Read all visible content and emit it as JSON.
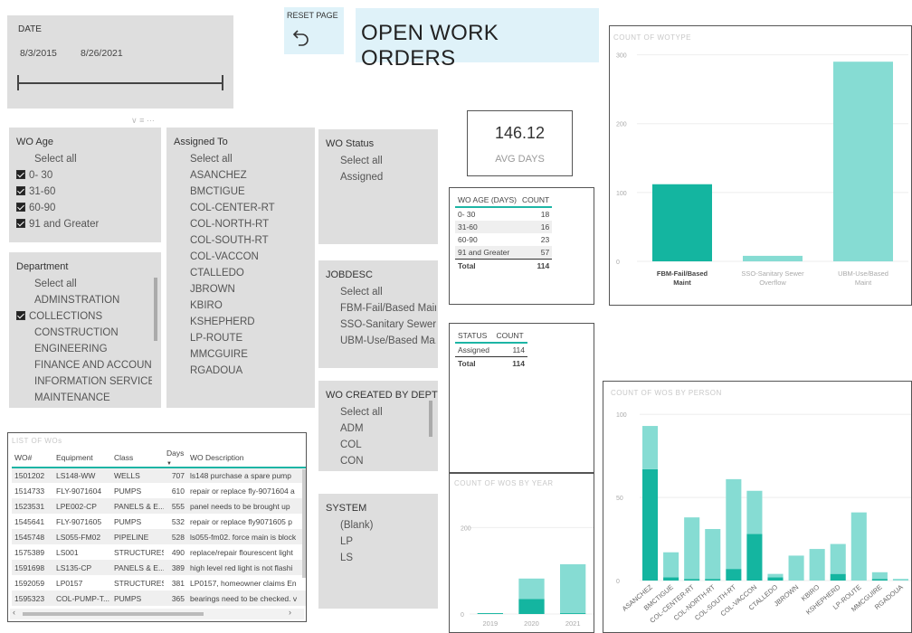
{
  "date_slicer": {
    "title": "DATE",
    "start": "8/3/2015",
    "end": "8/26/2021"
  },
  "reset": {
    "label": "RESET PAGE",
    "icon": "undo-arrow-icon"
  },
  "page_title": "OPEN WORK ORDERS",
  "avg_card": {
    "value": "146.12",
    "label": "AVG DAYS"
  },
  "wo_age_slicer": {
    "title": "WO Age",
    "items": [
      {
        "label": "Select all",
        "checked": false,
        "has_box": false
      },
      {
        "label": "0- 30",
        "checked": true,
        "has_box": true
      },
      {
        "label": "31-60",
        "checked": true,
        "has_box": true
      },
      {
        "label": "60-90",
        "checked": true,
        "has_box": true
      },
      {
        "label": "91 and Greater",
        "checked": true,
        "has_box": true
      }
    ]
  },
  "department_slicer": {
    "title": "Department",
    "items": [
      {
        "label": "Select all",
        "checked": false
      },
      {
        "label": "ADMINSTRATION",
        "checked": false
      },
      {
        "label": "COLLECTIONS",
        "checked": true
      },
      {
        "label": "CONSTRUCTION",
        "checked": false
      },
      {
        "label": "ENGINEERING",
        "checked": false
      },
      {
        "label": "FINANCE AND ACCOUNTI...",
        "checked": false
      },
      {
        "label": "INFORMATION SERVICES",
        "checked": false
      },
      {
        "label": "MAINTENANCE",
        "checked": false
      }
    ]
  },
  "assigned_slicer": {
    "title": "Assigned To",
    "items": [
      "Select all",
      "ASANCHEZ",
      "BMCTIGUE",
      "COL-CENTER-RT",
      "COL-NORTH-RT",
      "COL-SOUTH-RT",
      "COL-VACCON",
      "CTALLEDO",
      "JBROWN",
      "KBIRO",
      "KSHEPHERD",
      "LP-ROUTE",
      "MMCGUIRE",
      "RGADOUA"
    ]
  },
  "status_slicer": {
    "title": "WO Status",
    "items": [
      "Select all",
      "Assigned"
    ]
  },
  "jobdesc_slicer": {
    "title": "JOBDESC",
    "items": [
      "Select all",
      "FBM-Fail/Based Maint",
      "SSO-Sanitary Sewer...",
      "UBM-Use/Based Ma..."
    ]
  },
  "dept_created_slicer": {
    "title": "WO CREATED BY DEPT",
    "items": [
      "Select all",
      "ADM",
      "COL",
      "CON"
    ]
  },
  "system_slicer": {
    "title": "SYSTEM",
    "items": [
      "(Blank)",
      "LP",
      "LS"
    ]
  },
  "age_table": {
    "headers": [
      "WO AGE (DAYS)",
      "COUNT"
    ],
    "rows": [
      [
        "0- 30",
        "18"
      ],
      [
        "31-60",
        "16"
      ],
      [
        "60-90",
        "23"
      ],
      [
        "91 and Greater",
        "57"
      ]
    ],
    "total": [
      "Total",
      "114"
    ]
  },
  "status_table": {
    "headers": [
      "STATUS",
      "COUNT"
    ],
    "rows": [
      [
        "Assigned",
        "114"
      ]
    ],
    "total": [
      "Total",
      "114"
    ]
  },
  "wo_list": {
    "title": "LIST OF WOs",
    "headers": [
      "WO#",
      "Equipment",
      "Class",
      "Days",
      "WO Description"
    ],
    "rows": [
      [
        "1501202",
        "LS148-WW",
        "WELLS",
        "707",
        "ls148 purchase a spare pump"
      ],
      [
        "1514733",
        "FLY-9071604",
        "PUMPS",
        "610",
        "repair or replace fly-9071604 a"
      ],
      [
        "1523531",
        "LPE002-CP",
        "PANELS & E...",
        "555",
        "panel needs to be brought up"
      ],
      [
        "1545641",
        "FLY-9071605",
        "PUMPS",
        "532",
        "repair or replace fly9071605 p"
      ],
      [
        "1545748",
        "LS055-FM02",
        "PIPELINE",
        "528",
        "ls055-fm02. force main is block"
      ],
      [
        "1575389",
        "LS001",
        "STRUCTURES",
        "490",
        "replace/repair flourescent light"
      ],
      [
        "1591698",
        "LS135-CP",
        "PANELS & E...",
        "389",
        "high level red light is not flashi"
      ],
      [
        "1592059",
        "LP0157",
        "STRUCTURES",
        "381",
        "LP0157, homeowner claims En"
      ],
      [
        "1595323",
        "COL-PUMP-T...",
        "PUMPS",
        "365",
        "bearings need to be checked. v"
      ]
    ]
  },
  "colors": {
    "dark_teal": "#14b5a0",
    "light_teal": "#86dcd3",
    "slicer_bg": "#dedede",
    "title_bg": "#dff2f9"
  },
  "chart_data": [
    {
      "type": "bar",
      "title": "COUNT OF WOTYPE",
      "categories": [
        "FBM-Fail/Based Maint",
        "SSO-Sanitary Sewer Overflow",
        "UBM-Use/Based Maint"
      ],
      "values": [
        112,
        8,
        290
      ],
      "yticks": [
        "300",
        "200",
        "100",
        "0"
      ],
      "ylim": [
        0,
        310
      ]
    },
    {
      "type": "bar",
      "title": "COUNT OF WOS BY YEAR",
      "categories": [
        "2019",
        "2020",
        "2021"
      ],
      "series": [
        {
          "values": [
            2,
            35,
            2
          ]
        },
        {
          "values": [
            0,
            47,
            113
          ]
        }
      ],
      "yticks": [
        "200",
        "0"
      ],
      "ylim": [
        0,
        230
      ]
    },
    {
      "type": "bar",
      "title": "COUNT OF WOS BY PERSON",
      "categories": [
        "ASANCHEZ",
        "BMCTIGUE",
        "COL-CENTER-RT",
        "COL-NORTH-RT",
        "COL-SOUTH-RT",
        "COL-VACCON",
        "CTALLEDO",
        "JBROWN",
        "KBIRO",
        "KSHEPHERD",
        "LP-ROUTE",
        "MMCGUIRE",
        "RGADOUA"
      ],
      "series": [
        {
          "values": [
            67,
            2,
            1,
            1,
            7,
            28,
            2,
            0,
            0,
            4,
            0,
            1,
            0
          ]
        },
        {
          "values": [
            26,
            15,
            37,
            30,
            54,
            26,
            2,
            15,
            19,
            18,
            41,
            4,
            1
          ]
        }
      ],
      "yticks": [
        "100",
        "50",
        "0"
      ],
      "ylim": [
        0,
        105
      ]
    }
  ]
}
